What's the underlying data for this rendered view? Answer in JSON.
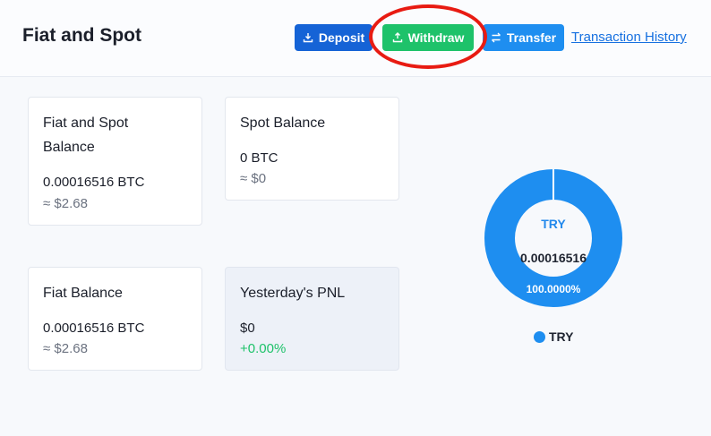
{
  "header": {
    "title": "Fiat and Spot",
    "deposit_label": "Deposit",
    "withdraw_label": "Withdraw",
    "transfer_label": "Transfer",
    "history_link": "Transaction History"
  },
  "cards": {
    "fiat_spot": {
      "title_line1": "Fiat and Spot",
      "title_line2": "Balance",
      "value": "0.00016516 BTC",
      "usd": "≈ $2.68"
    },
    "spot": {
      "title": "Spot Balance",
      "value": "0 BTC",
      "usd": "≈ $0"
    },
    "fiat": {
      "title": "Fiat Balance",
      "value": "0.00016516 BTC",
      "usd": "≈ $2.68"
    },
    "pnl": {
      "title": "Yesterday's PNL",
      "value": "$0",
      "change": "+0.00%"
    }
  },
  "chart_data": {
    "type": "pie",
    "categories": [
      "TRY"
    ],
    "values": [
      100
    ],
    "center_label": "TRY",
    "center_value": "0.00016516",
    "slice_label": "100.0000%",
    "legend": [
      "TRY"
    ],
    "legend_position": "bottom",
    "colors": [
      "#1e8ef0"
    ]
  },
  "colors": {
    "deposit": "#1563d6",
    "withdraw": "#1ec26a",
    "transfer": "#1e8ef0",
    "link": "#1670e0",
    "positive": "#1ec26a",
    "annotation": "#e81b12"
  }
}
